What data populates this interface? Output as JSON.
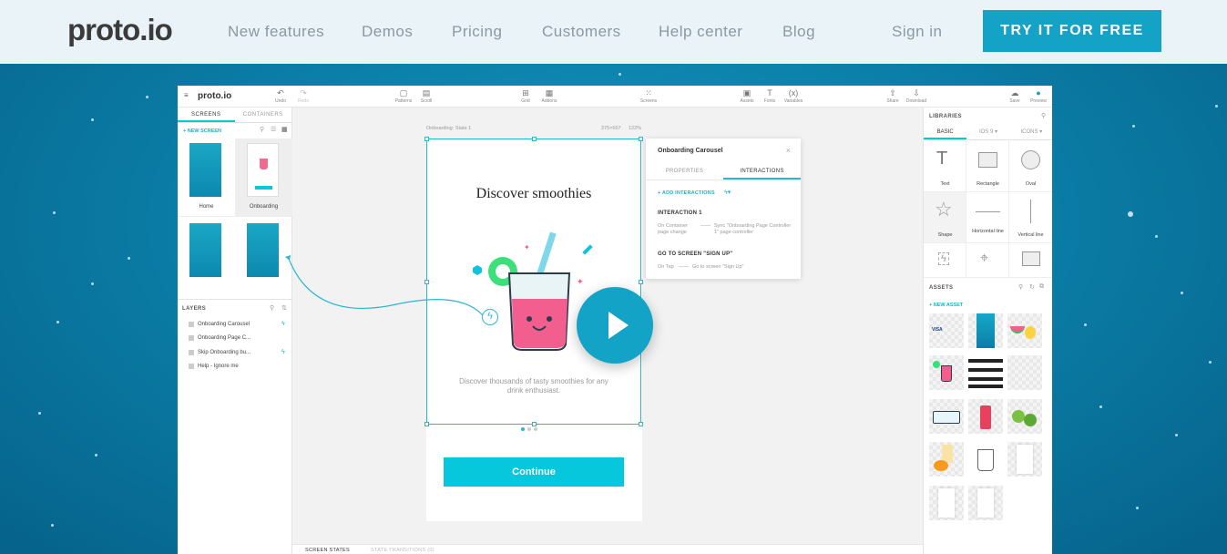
{
  "nav": {
    "logo": "proto.io",
    "links": [
      "New features",
      "Demos",
      "Pricing",
      "Customers",
      "Help center",
      "Blog"
    ],
    "sign_in": "Sign in",
    "cta": "TRY IT FOR FREE"
  },
  "app": {
    "brand": "proto.io",
    "toolbar": {
      "undo": "Undo",
      "redo": "Redo",
      "patterns": "Patterns",
      "scroll": "Scroll",
      "grid": "Grid",
      "addons": "Addons",
      "screens": "Screens",
      "assets": "Assets",
      "fonts": "Fonts",
      "variables": "Variables",
      "share": "Share",
      "download": "Download",
      "save": "Save",
      "preview": "Preview"
    },
    "left": {
      "tabs": [
        "SCREENS",
        "CONTAINERS"
      ],
      "new_screen": "+ NEW SCREEN",
      "screens": [
        "Home",
        "Onboarding"
      ],
      "layers_title": "LAYERS",
      "layers": [
        "Onboarding Carousel",
        "Onboarding Page C...",
        "Skip Onboarding bu...",
        "Help - Ignore me"
      ]
    },
    "canvas": {
      "state_label": "Onboarding: State 1",
      "size": "375×667",
      "zoom": "122%",
      "title": "Discover smoothies",
      "subtitle": "Discover thousands of tasty smoothies for any drink enthusiast.",
      "continue": "Continue",
      "bottom_tabs": [
        "SCREEN STATES",
        "STATE TRANSITIONS (0)"
      ]
    },
    "popover": {
      "title": "Onboarding Carousel",
      "tabs": [
        "PROPERTIES",
        "INTERACTIONS"
      ],
      "add": "+ ADD INTERACTIONS",
      "interaction_title": "INTERACTION 1",
      "trigger": "On Container page change",
      "action": "Sync \"Onboarding Page Controller 1\" page controller",
      "goto_title": "GO TO SCREEN \"SIGN UP\"",
      "goto_trigger": "On Tap",
      "goto_action": "Go to screen \"Sign Up\""
    },
    "right": {
      "libraries": "LIBRARIES",
      "tabs": [
        "BASIC",
        "IOS 9 ▾",
        "ICONS ▾"
      ],
      "shapes": [
        "Text",
        "Rectangle",
        "Oval",
        "Shape",
        "Horizontal line",
        "Vertical line"
      ],
      "assets": "ASSETS",
      "new_asset": "+ NEW ASSET",
      "visa": "VISA"
    }
  },
  "colors": {
    "accent": "#14a3c7",
    "cta_bg": "#14a3c7",
    "continue_bg": "#06c7dc",
    "background": "#0b7ea7"
  },
  "icons": [
    "play-icon",
    "menu-icon",
    "undo-icon",
    "redo-icon",
    "search-icon",
    "close-icon",
    "lightning-icon"
  ]
}
